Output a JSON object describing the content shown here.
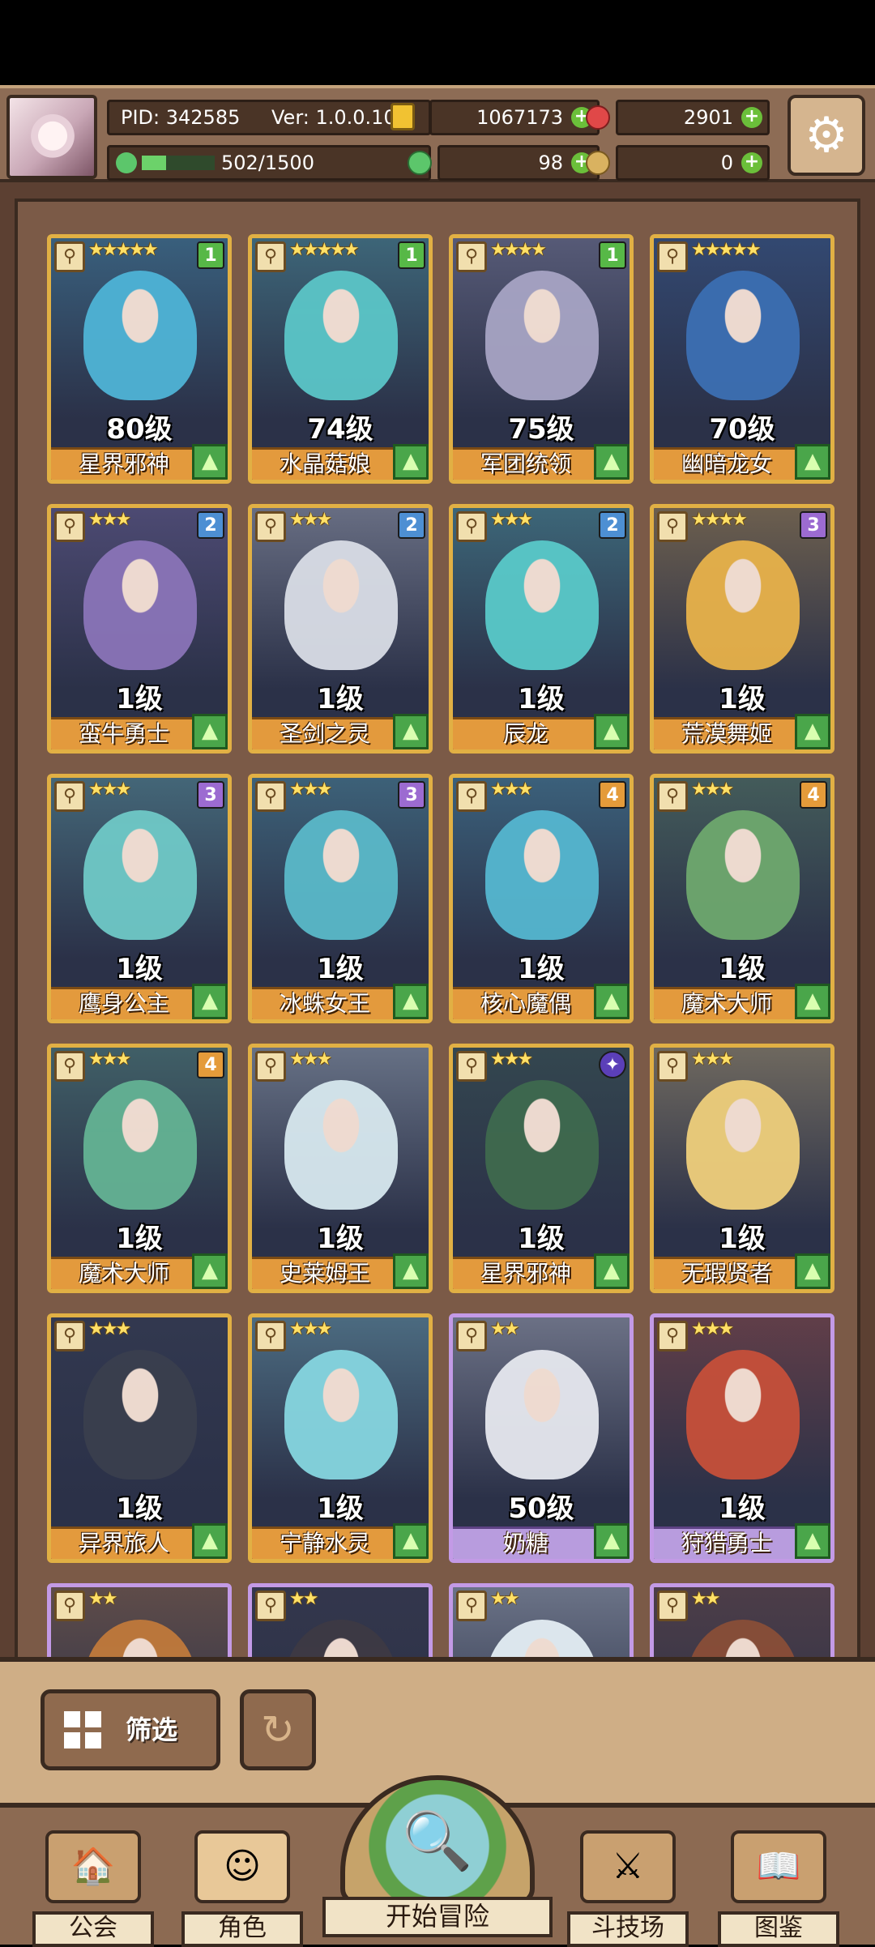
{
  "header": {
    "pid_label": "PID: 342585",
    "version_label": "Ver: 1.0.0.10",
    "gold": "1067173",
    "gems": "2901",
    "clover": "98",
    "bag": "0",
    "xp_text": "502/1500",
    "xp_progress": 0.335
  },
  "cards": [
    {
      "level": "80级",
      "name": "星界邪神",
      "stars": "★★★★★",
      "tier": "1",
      "tier_color": "green",
      "frame": "gold",
      "hair": "#4fb4d6"
    },
    {
      "level": "74级",
      "name": "水晶菇娘",
      "stars": "★★★★★",
      "tier": "1",
      "tier_color": "green",
      "frame": "gold",
      "hair": "#5bc6c8"
    },
    {
      "level": "75级",
      "name": "军团统领",
      "stars": "★★★★",
      "tier": "1",
      "tier_color": "green",
      "frame": "gold",
      "hair": "#a7a4c4"
    },
    {
      "level": "70级",
      "name": "幽暗龙女",
      "stars": "★★★★★",
      "tier": "",
      "tier_color": "none",
      "frame": "gold",
      "hair": "#3c6fb3"
    },
    {
      "level": "1级",
      "name": "蛮牛勇士",
      "stars": "★★★",
      "tier": "2",
      "tier_color": "blue",
      "frame": "gold",
      "hair": "#8a74b8"
    },
    {
      "level": "1级",
      "name": "圣剑之灵",
      "stars": "★★★",
      "tier": "2",
      "tier_color": "blue",
      "frame": "gold",
      "hair": "#d9dde6"
    },
    {
      "level": "1级",
      "name": "辰龙",
      "stars": "★★★",
      "tier": "2",
      "tier_color": "blue",
      "frame": "gold",
      "hair": "#59c9c9"
    },
    {
      "level": "1级",
      "name": "荒漠舞姬",
      "stars": "★★★★",
      "tier": "3",
      "tier_color": "violet",
      "frame": "gold",
      "hair": "#e8b24a"
    },
    {
      "level": "1级",
      "name": "鹰身公主",
      "stars": "★★★",
      "tier": "3",
      "tier_color": "violet",
      "frame": "gold",
      "hair": "#6fc9c7"
    },
    {
      "level": "1级",
      "name": "冰蛛女王",
      "stars": "★★★",
      "tier": "3",
      "tier_color": "violet",
      "frame": "gold",
      "hair": "#5ab9c9"
    },
    {
      "level": "1级",
      "name": "核心魔偶",
      "stars": "★★★",
      "tier": "4",
      "tier_color": "orange",
      "frame": "gold",
      "hair": "#55b7d0"
    },
    {
      "level": "1级",
      "name": "魔术大师",
      "stars": "★★★",
      "tier": "4",
      "tier_color": "orange",
      "frame": "gold",
      "hair": "#6ea86e"
    },
    {
      "level": "1级",
      "name": "魔术大师",
      "stars": "★★★",
      "tier": "4",
      "tier_color": "orange",
      "frame": "gold",
      "hair": "#64b394"
    },
    {
      "level": "1级",
      "name": "史莱姆王",
      "stars": "★★★",
      "tier": "",
      "tier_color": "none",
      "frame": "gold",
      "hair": "#d7e8ef"
    },
    {
      "level": "1级",
      "name": "星界邪神",
      "stars": "★★★",
      "tier": "✦",
      "tier_color": "special",
      "frame": "gold",
      "hair": "#3f6a4e"
    },
    {
      "level": "1级",
      "name": "无瑕贤者",
      "stars": "★★★",
      "tier": "",
      "tier_color": "none",
      "frame": "gold",
      "hair": "#efcf7c"
    },
    {
      "level": "1级",
      "name": "异界旅人",
      "stars": "★★★",
      "tier": "",
      "tier_color": "none",
      "frame": "gold",
      "hair": "#3a3f4e"
    },
    {
      "level": "1级",
      "name": "宁静水灵",
      "stars": "★★★",
      "tier": "",
      "tier_color": "none",
      "frame": "gold",
      "hair": "#86d6e0"
    },
    {
      "level": "50级",
      "name": "奶糖",
      "stars": "★★",
      "tier": "",
      "tier_color": "none",
      "frame": "purple",
      "hair": "#e6e8ef"
    },
    {
      "level": "1级",
      "name": "狩猎勇士",
      "stars": "★★★",
      "tier": "",
      "tier_color": "none",
      "frame": "purple",
      "hair": "#c6503a"
    },
    {
      "level": "",
      "name": "",
      "stars": "★★",
      "tier": "",
      "tier_color": "none",
      "frame": "purple",
      "hair": "#c07a3c"
    },
    {
      "level": "",
      "name": "",
      "stars": "★★",
      "tier": "",
      "tier_color": "none",
      "frame": "purple",
      "hair": "#3e3a44"
    },
    {
      "level": "",
      "name": "",
      "stars": "★★",
      "tier": "",
      "tier_color": "none",
      "frame": "purple",
      "hair": "#e4eef4"
    },
    {
      "level": "",
      "name": "",
      "stars": "★★",
      "tier": "",
      "tier_color": "none",
      "frame": "purple",
      "hair": "#8a4e38"
    }
  ],
  "filter": {
    "filter_label": "筛选"
  },
  "nav": {
    "guild": "公会",
    "characters": "角色",
    "start": "开始冒险",
    "arena": "斗技场",
    "codex": "图鉴"
  }
}
